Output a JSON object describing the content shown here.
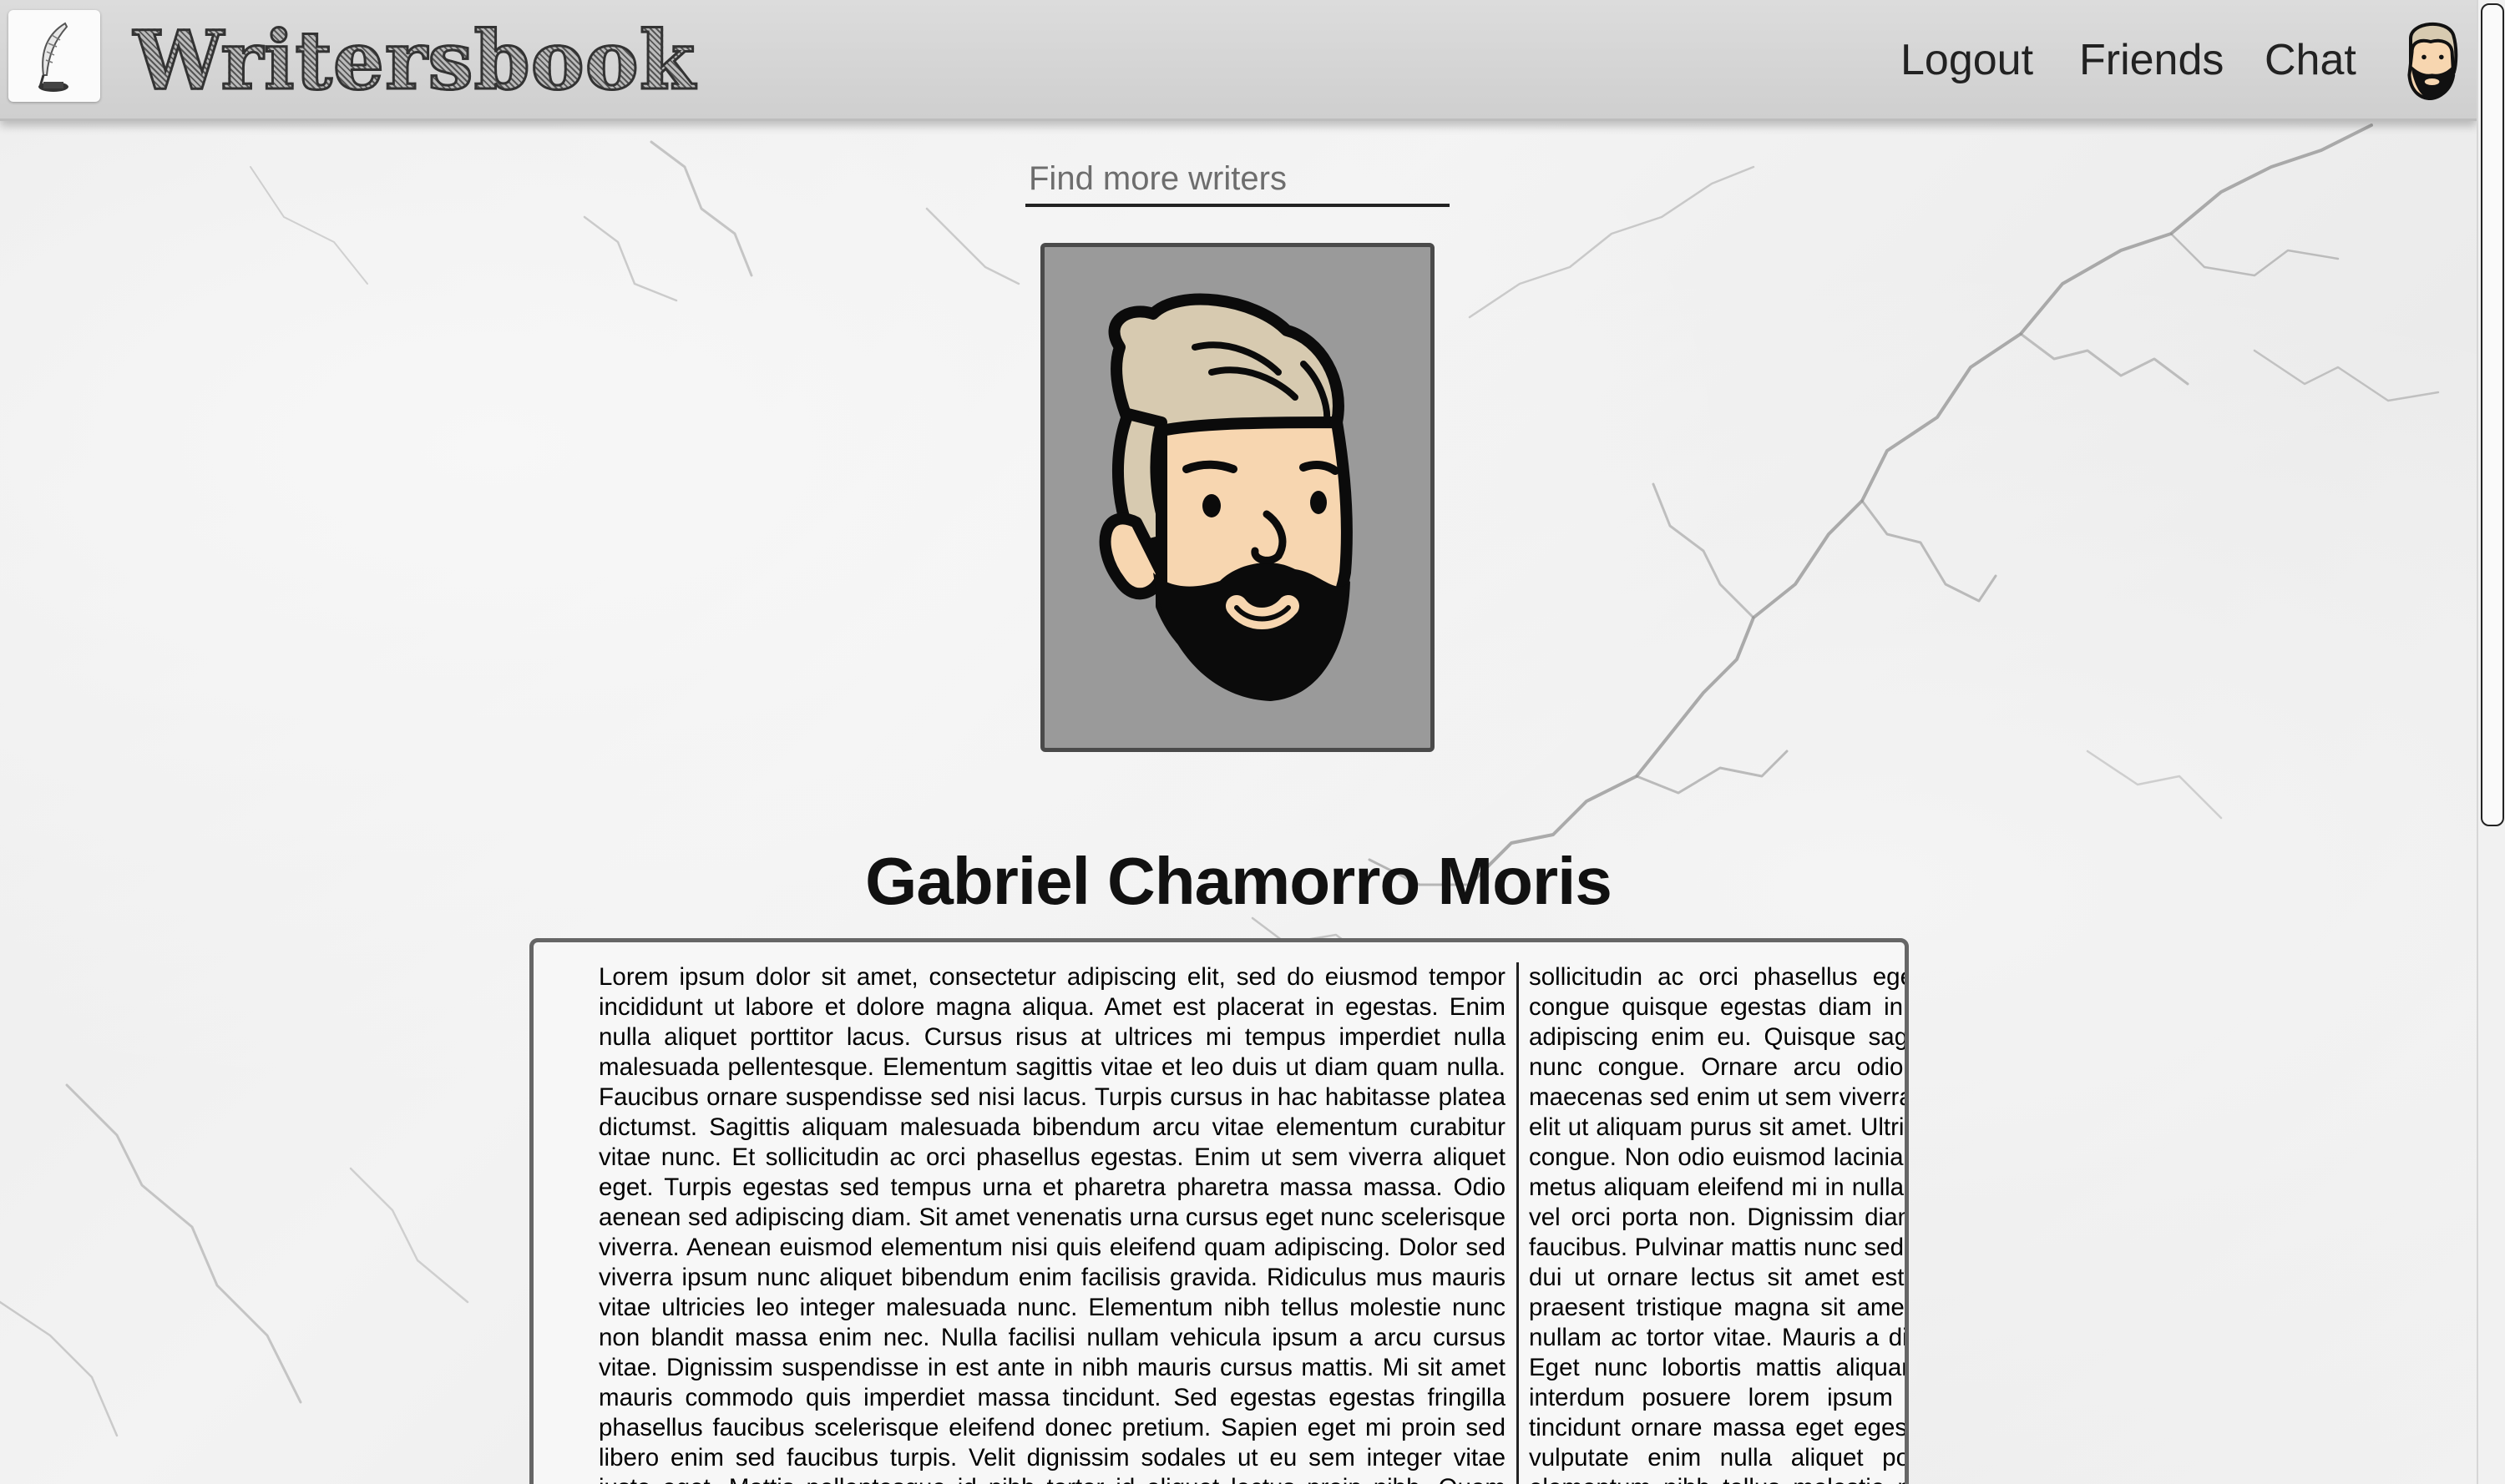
{
  "header": {
    "brand": "Writersbook",
    "nav": {
      "logout": "Logout",
      "friends": "Friends",
      "chat": "Chat"
    },
    "icons": {
      "logo": "quill-pen-icon",
      "user_avatar": "bearded-man-avatar"
    }
  },
  "search": {
    "placeholder": "Find more writers",
    "value": ""
  },
  "profile": {
    "picture": "bearded-man-avatar",
    "name": "Gabriel Chamorro Moris",
    "bio": "Lorem ipsum dolor sit amet, consectetur adipiscing elit, sed do eiusmod tempor incididunt ut labore et dolore magna aliqua. Amet est placerat in egestas. Enim nulla aliquet porttitor lacus. Cursus risus at ultrices mi tempus imperdiet nulla malesuada pellentesque. Elementum sagittis vitae et leo duis ut diam quam nulla. Faucibus ornare suspendisse sed nisi lacus. Turpis cursus in hac habitasse platea dictumst. Sagittis aliquam malesuada bibendum arcu vitae elementum curabitur vitae nunc. Et sollicitudin ac orci phasellus egestas. Enim ut sem viverra aliquet eget. Turpis egestas sed tempus urna et pharetra pharetra massa massa. Odio aenean sed adipiscing diam. Sit amet venenatis urna cursus eget nunc scelerisque viverra. Aenean euismod elementum nisi quis eleifend quam adipiscing. Dolor sed viverra ipsum nunc aliquet bibendum enim facilisis gravida. Ridiculus mus mauris vitae ultricies leo integer malesuada nunc. Elementum nibh tellus molestie nunc non blandit massa enim nec. Nulla facilisi nullam vehicula ipsum a arcu cursus vitae. Dignissim suspendisse in est ante in nibh mauris cursus mattis. Mi sit amet mauris commodo quis imperdiet massa tincidunt. Sed egestas egestas fringilla phasellus faucibus scelerisque eleifend donec pretium. Sapien eget mi proin sed libero enim sed faucibus turpis. Velit dignissim sodales ut eu sem integer vitae justo eget. Mattis pellentesque id nibh tortor id aliquet lectus proin nibh. Quam vulputate dignissim suspendisse in est ante in nibh mauris. In fermentum et sollicitudin ac orci phasellus egestas tellus rutrum. Bibendum neque egestas congue quisque egestas diam in arcu. Viverra aliquet eget sit amet tellus cras adipiscing enim eu. Quisque sagittis purus sit amet volutpat consequat mauris nunc congue. Ornare arcu odio ut sem nulla pharetra diam sit amet. Diam maecenas sed enim ut sem viverra aliquet eget sit. Sit amet consectetur adipiscing elit ut aliquam purus sit amet. Ultrices in iaculis nunc sed augue lacus viverra vitae congue. Non odio euismod lacinia at quis risus sed vulputate odio. Nunc id cursus metus aliquam eleifend mi in nulla. Scelerisque felis imperdiet proin fermentum leo vel orci porta non. Dignissim diam quis enim lobortis scelerisque fermentum dui faucibus. Pulvinar mattis nunc sed blandit libero volutpat sed cras ornare. Tincidunt dui ut ornare lectus sit amet est placerat in. Egestas integer eget aliquet nibh praesent tristique magna sit amet. Ut tortor pretium viverra suspendisse potenti nullam ac tortor vitae. Mauris a diam maecenas sed enim ut sem viverra aliquet. Eget nunc lobortis mattis aliquam faucibus purus in massa tempor. Faucibus interdum posuere lorem ipsum dolor sit amet consectetur adipiscing. Morbi tincidunt ornare massa eget egestas purus viverra accumsan in. Sit amet mattis vulputate enim nulla aliquet porttitor lacus luctus. Tempor orci eu lobortis elementum nibh tellus molestie nunc non. Morbi tristique senectus et netus et malesuada fames ac turpis. Elementum eu facilisis sed odio morbi quis commodo odio aenean. Lacus sed viverra tellus in hac habitasse platea dictumst vestibulum. Auctor elit sed vulputate mi sit amet mauris commodo quis. Quis hendrerit dolor magna eget est lorem ipsum dolor sit amet."
  }
}
